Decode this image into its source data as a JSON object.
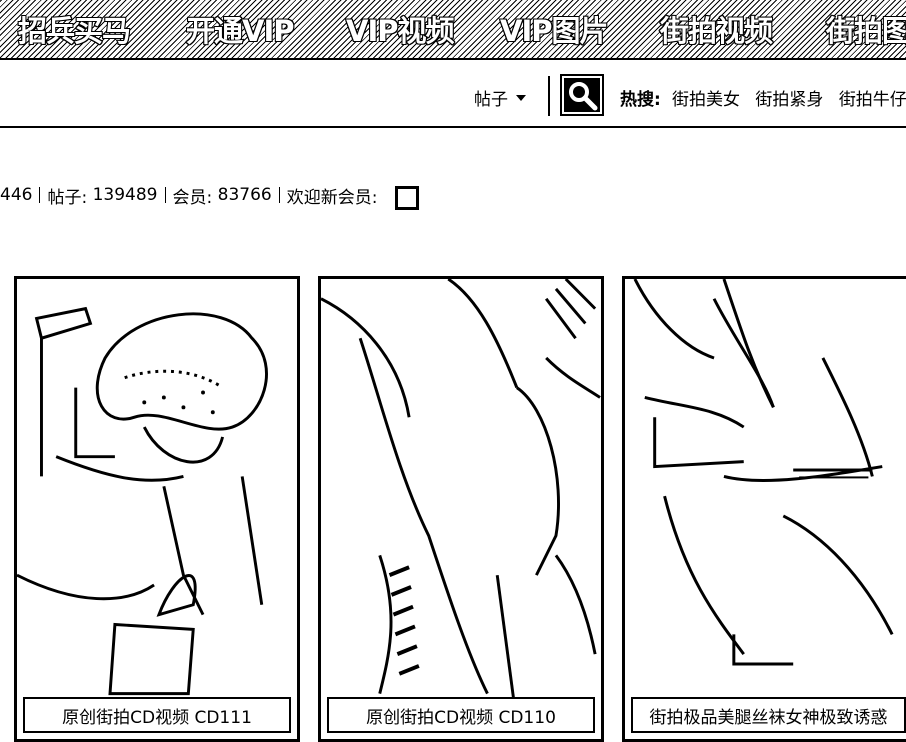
{
  "nav": {
    "items": [
      "招兵买马",
      "开通VIP",
      "VIP视频",
      "VIP图片",
      "街拍视频",
      "街拍图"
    ]
  },
  "search": {
    "type_label": "帖子",
    "icon": "search-icon",
    "hot_label": "热搜:",
    "hot_links": [
      "街拍美女",
      "街拍紧身",
      "街拍牛仔"
    ]
  },
  "stats": {
    "topics": "446",
    "posts_label": "帖子:",
    "posts": "139489",
    "members_label": "会员:",
    "members": "83766",
    "welcome_label": "欢迎新会员:"
  },
  "cards": [
    {
      "caption": "原创街拍CD视频 CD111"
    },
    {
      "caption": "原创街拍CD视频 CD110"
    },
    {
      "caption": "街拍极品美腿丝袜女神极致诱惑"
    }
  ]
}
